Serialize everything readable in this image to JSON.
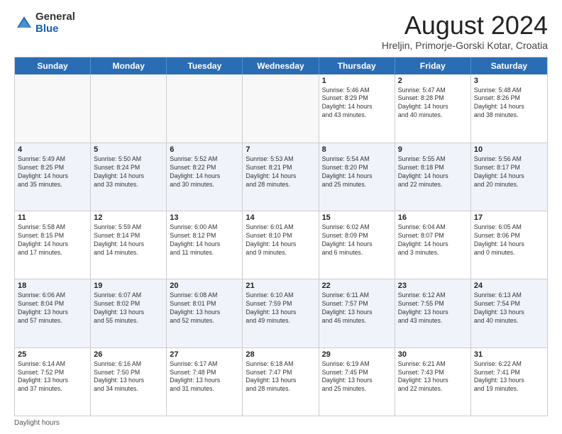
{
  "logo": {
    "general": "General",
    "blue": "Blue"
  },
  "title": "August 2024",
  "subtitle": "Hreljin, Primorje-Gorski Kotar, Croatia",
  "weekdays": [
    "Sunday",
    "Monday",
    "Tuesday",
    "Wednesday",
    "Thursday",
    "Friday",
    "Saturday"
  ],
  "footer": "Daylight hours",
  "rows": [
    [
      {
        "day": "",
        "info": "",
        "empty": true
      },
      {
        "day": "",
        "info": "",
        "empty": true
      },
      {
        "day": "",
        "info": "",
        "empty": true
      },
      {
        "day": "",
        "info": "",
        "empty": true
      },
      {
        "day": "1",
        "info": "Sunrise: 5:46 AM\nSunset: 8:29 PM\nDaylight: 14 hours\nand 43 minutes."
      },
      {
        "day": "2",
        "info": "Sunrise: 5:47 AM\nSunset: 8:28 PM\nDaylight: 14 hours\nand 40 minutes."
      },
      {
        "day": "3",
        "info": "Sunrise: 5:48 AM\nSunset: 8:26 PM\nDaylight: 14 hours\nand 38 minutes."
      }
    ],
    [
      {
        "day": "4",
        "info": "Sunrise: 5:49 AM\nSunset: 8:25 PM\nDaylight: 14 hours\nand 35 minutes."
      },
      {
        "day": "5",
        "info": "Sunrise: 5:50 AM\nSunset: 8:24 PM\nDaylight: 14 hours\nand 33 minutes."
      },
      {
        "day": "6",
        "info": "Sunrise: 5:52 AM\nSunset: 8:22 PM\nDaylight: 14 hours\nand 30 minutes."
      },
      {
        "day": "7",
        "info": "Sunrise: 5:53 AM\nSunset: 8:21 PM\nDaylight: 14 hours\nand 28 minutes."
      },
      {
        "day": "8",
        "info": "Sunrise: 5:54 AM\nSunset: 8:20 PM\nDaylight: 14 hours\nand 25 minutes."
      },
      {
        "day": "9",
        "info": "Sunrise: 5:55 AM\nSunset: 8:18 PM\nDaylight: 14 hours\nand 22 minutes."
      },
      {
        "day": "10",
        "info": "Sunrise: 5:56 AM\nSunset: 8:17 PM\nDaylight: 14 hours\nand 20 minutes."
      }
    ],
    [
      {
        "day": "11",
        "info": "Sunrise: 5:58 AM\nSunset: 8:15 PM\nDaylight: 14 hours\nand 17 minutes."
      },
      {
        "day": "12",
        "info": "Sunrise: 5:59 AM\nSunset: 8:14 PM\nDaylight: 14 hours\nand 14 minutes."
      },
      {
        "day": "13",
        "info": "Sunrise: 6:00 AM\nSunset: 8:12 PM\nDaylight: 14 hours\nand 11 minutes."
      },
      {
        "day": "14",
        "info": "Sunrise: 6:01 AM\nSunset: 8:10 PM\nDaylight: 14 hours\nand 9 minutes."
      },
      {
        "day": "15",
        "info": "Sunrise: 6:02 AM\nSunset: 8:09 PM\nDaylight: 14 hours\nand 6 minutes."
      },
      {
        "day": "16",
        "info": "Sunrise: 6:04 AM\nSunset: 8:07 PM\nDaylight: 14 hours\nand 3 minutes."
      },
      {
        "day": "17",
        "info": "Sunrise: 6:05 AM\nSunset: 8:06 PM\nDaylight: 14 hours\nand 0 minutes."
      }
    ],
    [
      {
        "day": "18",
        "info": "Sunrise: 6:06 AM\nSunset: 8:04 PM\nDaylight: 13 hours\nand 57 minutes."
      },
      {
        "day": "19",
        "info": "Sunrise: 6:07 AM\nSunset: 8:02 PM\nDaylight: 13 hours\nand 55 minutes."
      },
      {
        "day": "20",
        "info": "Sunrise: 6:08 AM\nSunset: 8:01 PM\nDaylight: 13 hours\nand 52 minutes."
      },
      {
        "day": "21",
        "info": "Sunrise: 6:10 AM\nSunset: 7:59 PM\nDaylight: 13 hours\nand 49 minutes."
      },
      {
        "day": "22",
        "info": "Sunrise: 6:11 AM\nSunset: 7:57 PM\nDaylight: 13 hours\nand 46 minutes."
      },
      {
        "day": "23",
        "info": "Sunrise: 6:12 AM\nSunset: 7:55 PM\nDaylight: 13 hours\nand 43 minutes."
      },
      {
        "day": "24",
        "info": "Sunrise: 6:13 AM\nSunset: 7:54 PM\nDaylight: 13 hours\nand 40 minutes."
      }
    ],
    [
      {
        "day": "25",
        "info": "Sunrise: 6:14 AM\nSunset: 7:52 PM\nDaylight: 13 hours\nand 37 minutes."
      },
      {
        "day": "26",
        "info": "Sunrise: 6:16 AM\nSunset: 7:50 PM\nDaylight: 13 hours\nand 34 minutes."
      },
      {
        "day": "27",
        "info": "Sunrise: 6:17 AM\nSunset: 7:48 PM\nDaylight: 13 hours\nand 31 minutes."
      },
      {
        "day": "28",
        "info": "Sunrise: 6:18 AM\nSunset: 7:47 PM\nDaylight: 13 hours\nand 28 minutes."
      },
      {
        "day": "29",
        "info": "Sunrise: 6:19 AM\nSunset: 7:45 PM\nDaylight: 13 hours\nand 25 minutes."
      },
      {
        "day": "30",
        "info": "Sunrise: 6:21 AM\nSunset: 7:43 PM\nDaylight: 13 hours\nand 22 minutes."
      },
      {
        "day": "31",
        "info": "Sunrise: 6:22 AM\nSunset: 7:41 PM\nDaylight: 13 hours\nand 19 minutes."
      }
    ]
  ]
}
